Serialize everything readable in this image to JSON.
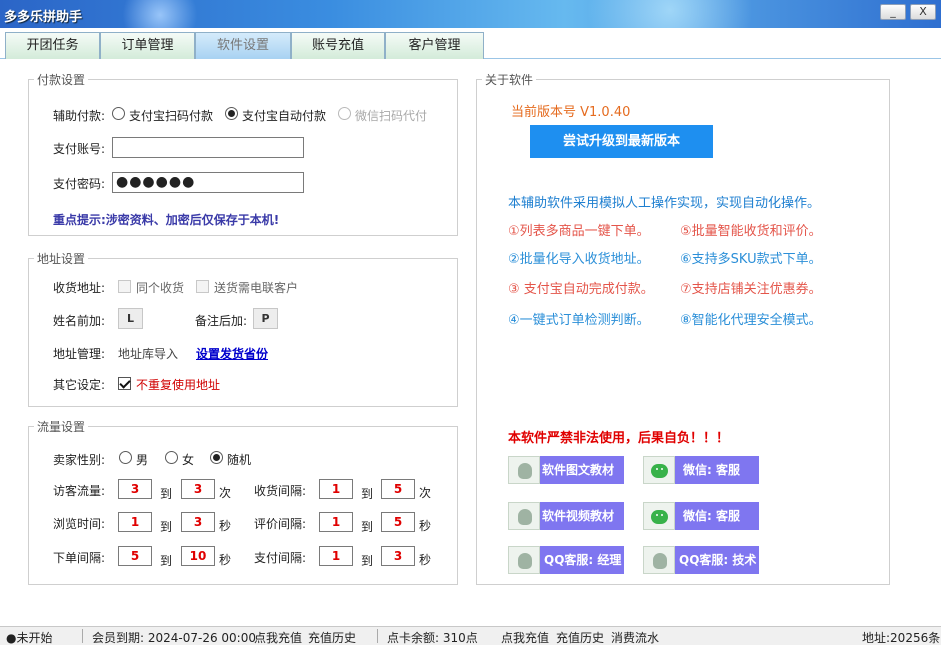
{
  "window": {
    "title": "多多乐拼助手",
    "minimize": "_",
    "close": "X"
  },
  "tabs": [
    "开团任务",
    "订单管理",
    "软件设置",
    "账号充值",
    "客户管理"
  ],
  "payment": {
    "group_title": "付款设置",
    "assist_label": "辅助付款:",
    "options": [
      "支付宝扫码付款",
      "支付宝自动付款",
      "微信扫码代付"
    ],
    "selected": "支付宝自动付款",
    "account_label": "支付账号:",
    "account_value": "",
    "password_label": "支付密码:",
    "password_value": "●●●●●●",
    "tip": "重点提示:涉密资料、加密后仅保存于本机!"
  },
  "address": {
    "group_title": "地址设置",
    "receive_label": "收货地址:",
    "same_receive": "同个收货",
    "send_telecom": "送货需电联客户",
    "name_prefix_label": "姓名前加:",
    "name_prefix_key": "L",
    "remark_label": "备注后加:",
    "remark_key": "P",
    "manage_label": "地址管理:",
    "import_text": "地址库导入",
    "set_province": "设置发货省份",
    "other_label": "其它设定:",
    "no_repeat": "不重复使用地址"
  },
  "traffic": {
    "group_title": "流量设置",
    "gender_label": "卖家性别:",
    "genders": [
      "男",
      "女",
      "随机"
    ],
    "gender_selected": "随机",
    "to": "到",
    "visitor_label": "访客流量:",
    "visitor": [
      "3",
      "3"
    ],
    "unit_times": "次",
    "receipt_label": "收货间隔:",
    "receipt": [
      "1",
      "5"
    ],
    "browse_label": "浏览时间:",
    "browse": [
      "1",
      "3"
    ],
    "unit_sec": "秒",
    "review_label": "评价间隔:",
    "review": [
      "1",
      "5"
    ],
    "order_label": "下单间隔:",
    "order": [
      "5",
      "10"
    ],
    "pay_label": "支付间隔:",
    "pay": [
      "1",
      "3"
    ]
  },
  "about": {
    "group_title": "关于软件",
    "version": "当前版本号 V1.0.40",
    "upgrade": "尝试升级到最新版本",
    "intro": "本辅助软件采用模拟人工操作实现，实现自动化操作。",
    "features": [
      "①列表多商品一键下单。",
      "⑤批量智能收货和评价。",
      "②批量化导入收货地址。",
      "⑥支持多SKU款式下单。",
      "③ 支付宝自动完成付款。",
      "⑦支持店铺关注优惠券。",
      "④一键式订单检测判断。",
      "⑧智能化代理安全模式。"
    ],
    "warning": "本软件严禁非法使用，后果自负！！！",
    "btn_tutorial_text": "软件图文教材",
    "btn_wechat1": "微信: 客服",
    "btn_tutorial_video": "软件视频教材",
    "btn_wechat2": "微信: 客服",
    "btn_qq_manager": "QQ客服: 经理",
    "btn_qq_tech": "QQ客服: 技术"
  },
  "status": {
    "state": "●未开始",
    "member": "会员到期: 2024-07-26 00:00",
    "recharge": "点我充值",
    "history": "充值历史",
    "points": "点卡余额: 310点",
    "recharge2": "点我充值",
    "history2": "充值历史",
    "consume": "消费流水",
    "address_count": "地址:20256条"
  },
  "colors": {
    "accent_blue": "#1e8ff0",
    "feature_red": "#e4554a",
    "feature_blue": "#2b8fd8",
    "warning_red": "#e00000",
    "button_purple": "#7f76f0"
  }
}
